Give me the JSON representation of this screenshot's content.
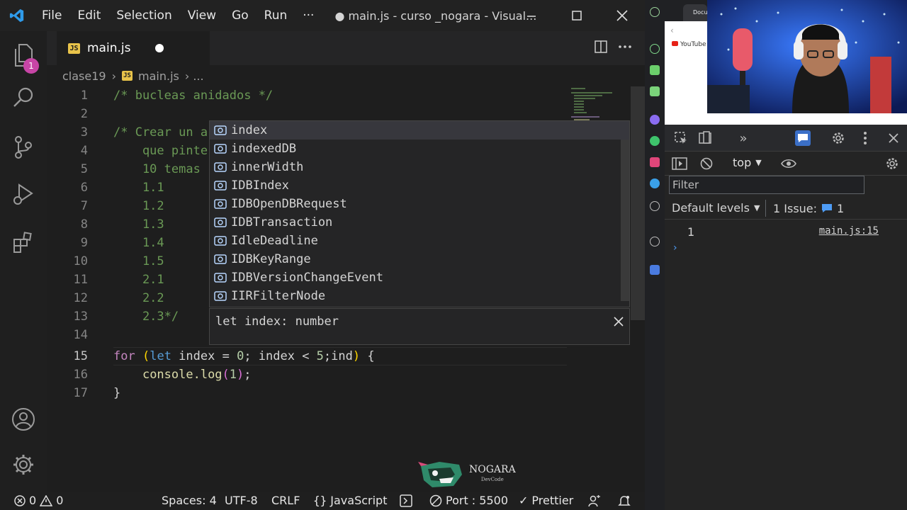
{
  "titlebar": {
    "menu": [
      "File",
      "Edit",
      "Selection",
      "View",
      "Go",
      "Run",
      "···"
    ],
    "title": "● main.js - curso _nogara - Visual..."
  },
  "activity": {
    "explorer_badge": "1"
  },
  "tab": {
    "label": "main.js"
  },
  "breadcrumb": {
    "folder": "clase19",
    "separator": "›",
    "file": "main.js",
    "tail": "› ..."
  },
  "editor": {
    "line_numbers": [
      "1",
      "2",
      "3",
      "4",
      "5",
      "6",
      "7",
      "8",
      "9",
      "10",
      "11",
      "12",
      "13",
      "14",
      "15",
      "16",
      "17"
    ],
    "lines": {
      "l1": "/* bucleas anidados */",
      "l3": "/* Crear un a",
      "l4": "    que pinte",
      "l5": "    10 temas",
      "l6": "    1.1",
      "l7": "    1.2",
      "l8": "    1.3",
      "l9": "    1.4",
      "l10": "    1.5",
      "l11": "    2.1",
      "l12": "    2.2",
      "l13": "    2.3*/",
      "l15_for": "for",
      "l15_open": "(",
      "l15_let": "let",
      "l15_a": " index = ",
      "l15_zero": "0",
      "l15_b": "; index < ",
      "l15_five": "5",
      "l15_c": ";ind",
      "l15_close": ")",
      "l15_brace": " {",
      "l16_indent": "    ",
      "l16_fn": "console.log",
      "l16_open": "(",
      "l16_num": "1",
      "l16_close": ")",
      "l16_semi": ";",
      "l17": "}"
    }
  },
  "suggest": {
    "items": [
      "index",
      "indexedDB",
      "innerWidth",
      "IDBIndex",
      "IDBOpenDBRequest",
      "IDBTransaction",
      "IdleDeadline",
      "IDBKeyRange",
      "IDBVersionChangeEvent",
      "IIRFilterNode"
    ],
    "detail": "let index: number"
  },
  "watermark": {
    "brand": "NOGARA",
    "sub": "DevCode"
  },
  "statusbar": {
    "errors": "0",
    "warnings": "0",
    "spaces": "Spaces: 4",
    "encoding": "UTF-8",
    "eol": "CRLF",
    "language": "JavaScript",
    "port": "Port : 5500",
    "prettier": "Prettier"
  },
  "browser": {
    "tab_label": "Docu",
    "youtube_item": "YouTube"
  },
  "devtools": {
    "context": "top",
    "filter_placeholder": "Filter",
    "levels": "Default levels",
    "issues_label": "1 Issue:",
    "issues_count": "1",
    "console_value": "1",
    "console_source": "main.js:15",
    "prompt": "›"
  },
  "colors": {
    "accent": "#007acc",
    "badge": "#c745a6",
    "keyword": "#c586c0",
    "comment": "#6a9955",
    "suggest_icon": "#b8d7ff"
  }
}
